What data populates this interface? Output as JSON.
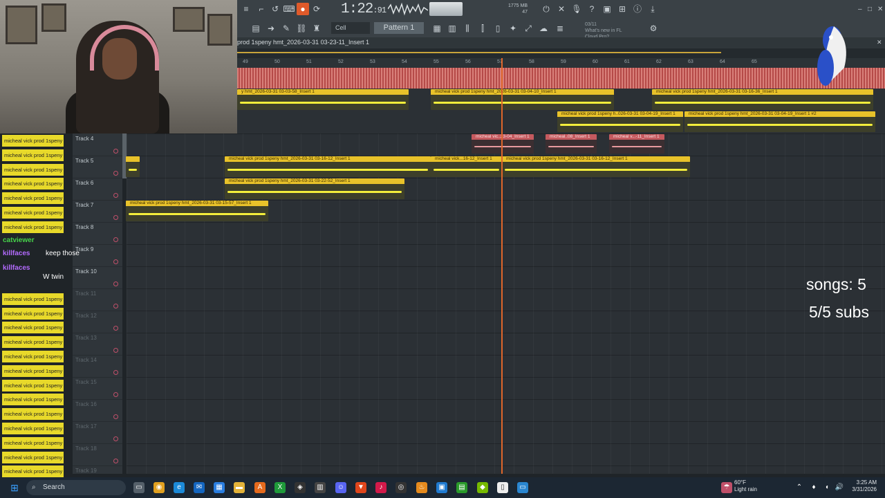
{
  "toolbar": {
    "time": "1:22",
    "time_frac": "91",
    "time_unit": "M:S:CS",
    "cpu": "1775 MB",
    "cpu_val": "47",
    "snap": "Cell",
    "pattern": "Pattern 1",
    "news": [
      "03/11",
      "What's new in FL",
      "Cloud Pro?"
    ],
    "icon_names": [
      "play-icon",
      "stop-icon",
      "record-icon",
      "pattern-song-icon",
      "metronome-icon",
      "undo-icon",
      "help-icon",
      "save-icon",
      "mixer-icon",
      "info-icon",
      "download-icon"
    ]
  },
  "playlist": {
    "title": "prod 1speny hmt_2026-03-31 03-23-11_Insert 1",
    "ruler": [
      "49",
      "50",
      "51",
      "52",
      "53",
      "54",
      "55",
      "56",
      "57",
      "58",
      "59",
      "60",
      "61",
      "62",
      "63",
      "64",
      "65"
    ]
  },
  "tracks": [
    {
      "name": "Track 4",
      "active": true
    },
    {
      "name": "Track 5",
      "active": true
    },
    {
      "name": "Track 6",
      "active": true
    },
    {
      "name": "Track 7",
      "active": true
    },
    {
      "name": "Track 8",
      "active": true
    },
    {
      "name": "Track 9",
      "active": true
    },
    {
      "name": "Track 10",
      "active": true
    },
    {
      "name": "Track 11",
      "active": false
    },
    {
      "name": "Track 12",
      "active": false
    },
    {
      "name": "Track 13",
      "active": false
    },
    {
      "name": "Track 14",
      "active": false
    },
    {
      "name": "Track 15",
      "active": false
    },
    {
      "name": "Track 16",
      "active": false
    },
    {
      "name": "Track 17",
      "active": false
    },
    {
      "name": "Track 18",
      "active": false
    },
    {
      "name": "Track 19",
      "active": false
    }
  ],
  "clips": {
    "top1": "y hmt_2026-03-31 03-03-58_Insert 1",
    "top2": "micheal vick prod 1speny hmt_2026-03-31 03-04-10_Insert 1",
    "top3": "micheal vick prod 1speny hmt_2026-03-31 03-16-36_Insert 1",
    "top4": "micheal vick prod 1speny h..026-03-31 03-04-19_Insert 1",
    "top5": "micheal vick prod 1speny hmt_2026-03-31 03-04-19_Insert 1 #2",
    "r1": "micheal vic..23-04_Insert 1",
    "r2": "micheal..08_Insert 1",
    "r3": "micheal v...-11_Insert 1",
    "t5a": "micheal vick prod 1speny hmt_2026-03-31 03-16-12_Insert 1",
    "t5b": "micheal vick...16-12_Insert 1",
    "t5c": "micheal vick prod 1speny hmt_2026-03-31 03-16-12_Insert 1",
    "t6": "micheal vick prod 1speny hmt_2026-03-31 03-22-52_Insert 1",
    "t7": "micheal vick prod 1speny hmt_2026-03-31 03-15-57_Insert 1"
  },
  "chat": {
    "item": "micheal vick prod 1speny",
    "msg1_user": "killfaces",
    "msg1_text": "keep those",
    "msg2_user": "killfaces",
    "msg2_text": "W twin",
    "msg0_user": "catviewer"
  },
  "overlay": {
    "songs": "songs: 5",
    "subs": "5/5 subs"
  },
  "taskbar": {
    "search": "Search",
    "weather_temp": "60°F",
    "weather_desc": "Light rain",
    "time": "3:25 AM",
    "date": "3/31/2026"
  },
  "colors": {
    "clip_yellow": "#e8c22a",
    "clip_red": "#c55a5f",
    "playhead": "#e0662a",
    "master_wave": "#b54a48"
  }
}
